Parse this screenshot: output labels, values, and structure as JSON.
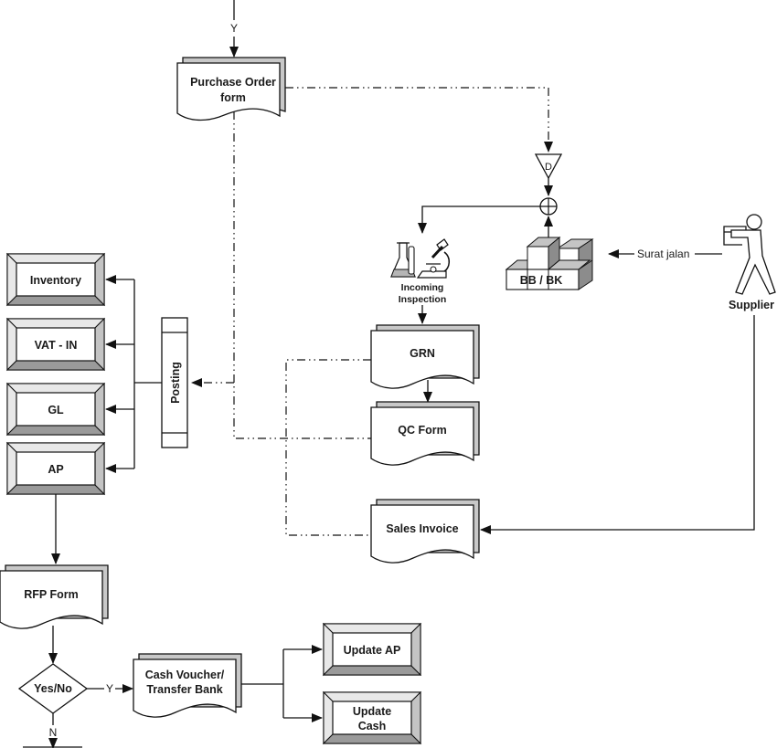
{
  "diagram": {
    "nodes": {
      "purchase_order": {
        "line1": "Purchase Order",
        "line2": "form"
      },
      "inventory": {
        "label": "Inventory"
      },
      "vat_in": {
        "label": "VAT - IN"
      },
      "gl": {
        "label": "GL"
      },
      "ap": {
        "label": "AP"
      },
      "posting": {
        "label": "Posting"
      },
      "grn": {
        "label": "GRN"
      },
      "qc_form": {
        "label": "QC Form"
      },
      "sales_invoice": {
        "label": "Sales Invoice"
      },
      "rfp_form": {
        "label": "RFP Form"
      },
      "decision": {
        "label": "Yes/No"
      },
      "cash_voucher": {
        "line1": "Cash Voucher/",
        "line2": "Transfer Bank"
      },
      "update_ap": {
        "label": "Update AP"
      },
      "update_cash": {
        "line1": "Update",
        "line2": "Cash"
      },
      "storage": {
        "label": "BB / BK"
      },
      "file_symbol": {
        "label": "D"
      },
      "incoming_inspection": {
        "line1": "Incoming",
        "line2": "Inspection"
      },
      "supplier": {
        "label": "Supplier"
      }
    },
    "edge_labels": {
      "yes_top": "Y",
      "yes_decision": "Y",
      "no_decision": "N",
      "surat_jalan": "Surat jalan"
    }
  }
}
